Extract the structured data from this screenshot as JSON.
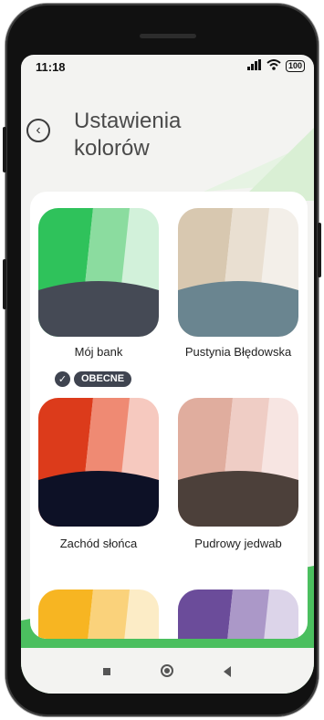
{
  "status_bar": {
    "time": "11:18",
    "signal": "4G",
    "battery": "100"
  },
  "header": {
    "title_line1": "Ustawienia",
    "title_line2": "kolorów"
  },
  "themes": [
    {
      "label": "Mój bank",
      "colors": [
        "#2fc25b",
        "#8bdc9f",
        "#d2f1da",
        "#454a55"
      ],
      "current": true
    },
    {
      "label": "Pustynia Błędowska",
      "colors": [
        "#d8c8b0",
        "#e9dfd1",
        "#f3efe9",
        "#6a8590"
      ]
    },
    {
      "label": "Zachód słońca",
      "colors": [
        "#dc3b1b",
        "#ef8a73",
        "#f6c9bf",
        "#0d1126"
      ]
    },
    {
      "label": "Pudrowy jedwab",
      "colors": [
        "#e0ad9e",
        "#efcdc5",
        "#f7e5e2",
        "#4c403a"
      ]
    },
    {
      "label": "",
      "colors": [
        "#f7b522",
        "#fad27b",
        "#fcecc6",
        "#ffffff"
      ]
    },
    {
      "label": "",
      "colors": [
        "#6b4c9a",
        "#ab98c8",
        "#dcd4e9",
        "#ffffff"
      ]
    }
  ],
  "current_badge": "OBECNE",
  "icons": {
    "back": "back-arrow-icon",
    "check": "check-icon",
    "wifi": "wifi-icon",
    "signal": "signal-icon",
    "battery": "battery-icon",
    "nav_recent": "square-icon",
    "nav_home": "circle-icon",
    "nav_back": "triangle-icon"
  },
  "accent_green": "#3fbf5a"
}
